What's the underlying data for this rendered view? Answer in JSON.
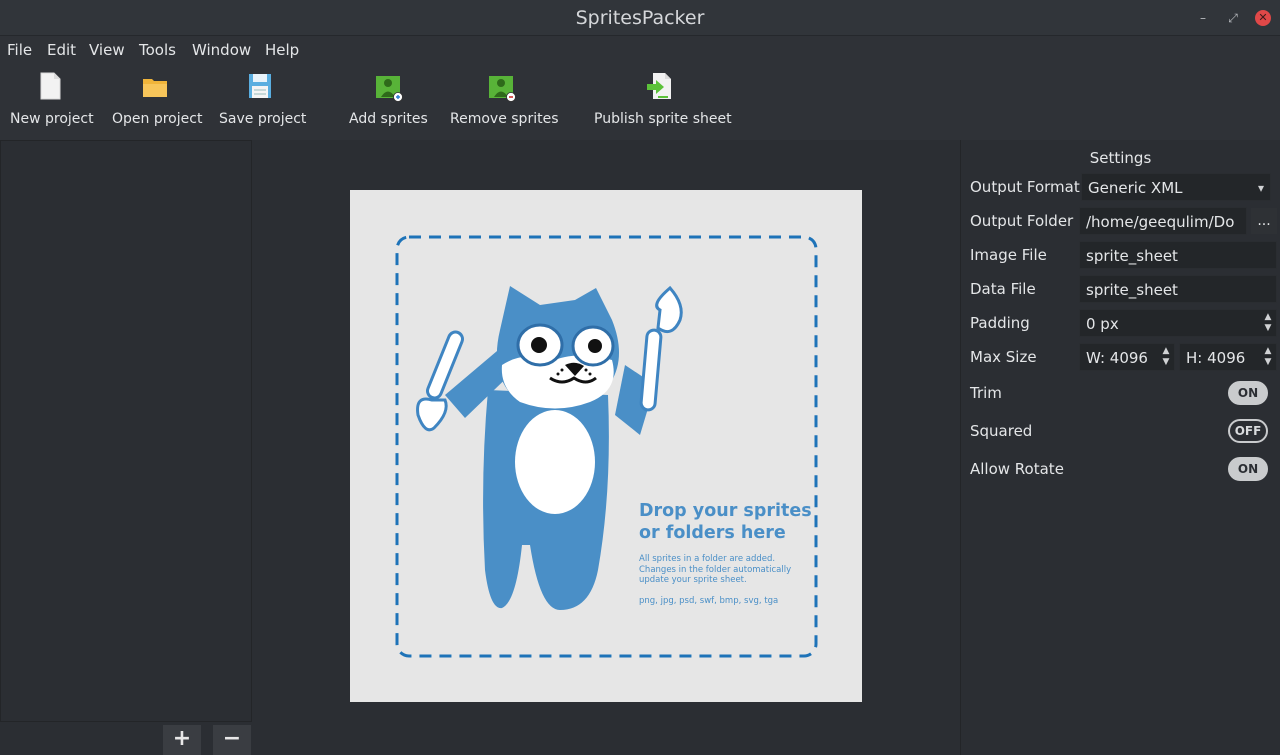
{
  "window": {
    "title": "SpritesPacker",
    "controls": [
      "minimize-icon",
      "maximize-icon",
      "close-icon"
    ]
  },
  "menu": {
    "file": "File",
    "edit": "Edit",
    "view": "View",
    "tools": "Tools",
    "window": "Window",
    "help": "Help"
  },
  "toolbar": {
    "new_project": "New project",
    "open_project": "Open project",
    "save_project": "Save project",
    "add_sprites": "Add sprites",
    "remove_sprites": "Remove sprites",
    "publish": "Publish sprite sheet"
  },
  "left_panel": {
    "add_button": "+",
    "remove_button": "−"
  },
  "drop_zone": {
    "title_line1": "Drop your sprites",
    "title_line2": "or folders here",
    "desc_line1": "All sprites in a folder are added.",
    "desc_line2": "Changes in the folder automatically",
    "desc_line3": "update your sprite sheet.",
    "formats": "png, jpg,  psd,  swf, bmp, svg, tga"
  },
  "settings": {
    "header": "Settings",
    "output_format_label": "Output Format",
    "output_format_value": "Generic XML",
    "output_folder_label": "Output Folder",
    "output_folder_value": "/home/geequlim/Do",
    "browse_label": "...",
    "image_file_label": "Image File",
    "image_file_value": "sprite_sheet",
    "data_file_label": "Data File",
    "data_file_value": "sprite_sheet",
    "padding_label": "Padding",
    "padding_value": "0 px",
    "max_size_label": "Max Size",
    "max_w_value": "W: 4096",
    "max_h_value": "H: 4096",
    "trim_label": "Trim",
    "trim_state": "ON",
    "squared_label": "Squared",
    "squared_state": "OFF",
    "allow_rotate_label": "Allow Rotate",
    "allow_rotate_state": "ON"
  },
  "colors": {
    "accent_blue": "#4a8fc7",
    "background": "#2b2e33",
    "card": "#e6e6e6"
  }
}
